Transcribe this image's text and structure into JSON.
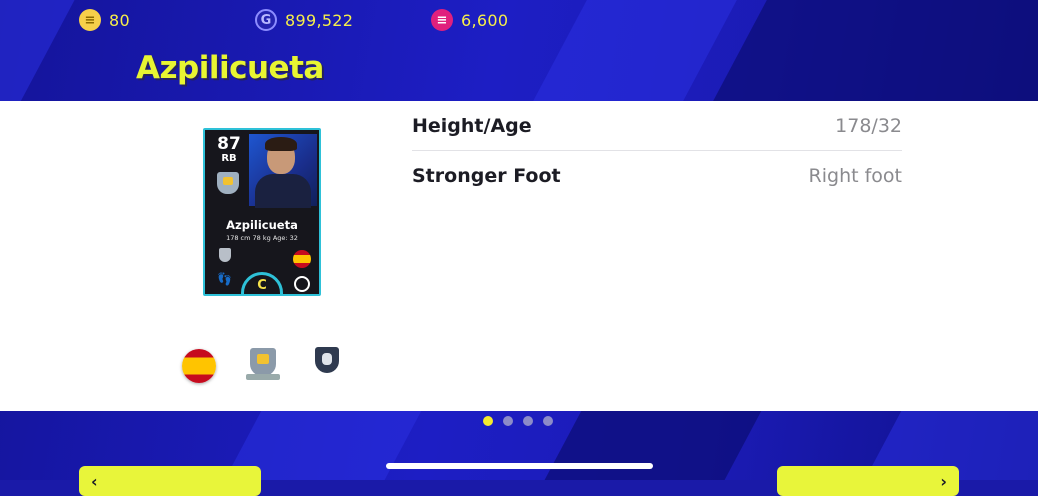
{
  "currencies": [
    {
      "icon": "e-coin-icon",
      "amount": "80"
    },
    {
      "icon": "gp-coin-icon",
      "amount": "899,522"
    },
    {
      "icon": "efootball-coin-icon",
      "amount": "6,600"
    }
  ],
  "player": {
    "title": "Azpilicueta",
    "card": {
      "rating": "87",
      "position": "RB",
      "name": "Azpilicueta",
      "info": "178 cm  78 kg  Age: 32",
      "condition": "C"
    }
  },
  "details": [
    {
      "label": "Height/Age",
      "value": "178/32"
    },
    {
      "label": "Stronger Foot",
      "value": "Right foot"
    }
  ],
  "pagination": {
    "total": 4,
    "active": 0
  },
  "buttons": {
    "left_label": "",
    "right_label": ""
  },
  "colors": {
    "accent": "#e8f53a",
    "card_border": "#2ec1d8",
    "panel": "#ffffff",
    "background": "#1d1ec4"
  }
}
